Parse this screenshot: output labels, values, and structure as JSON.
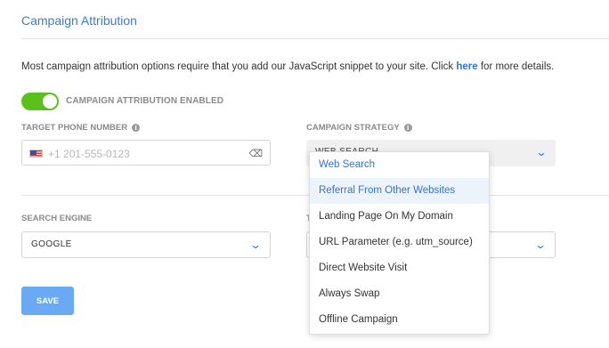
{
  "section": {
    "title": "Campaign Attribution"
  },
  "intro": {
    "text_before": "Most campaign attribution options require that you add our JavaScript snippet to your site. Click ",
    "link_text": "here",
    "text_after": " for more details."
  },
  "toggle": {
    "label": "CAMPAIGN ATTRIBUTION ENABLED",
    "on": true,
    "color": "#5cc01c"
  },
  "phone": {
    "label": "TARGET PHONE NUMBER",
    "placeholder": "+1 201-555-0123",
    "info_icon": "info-icon",
    "flag_icon": "us-flag-icon",
    "clear_icon": "eraser-icon"
  },
  "strategy": {
    "label": "CAMPAIGN STRATEGY",
    "value": "WEB SEARCH",
    "info_icon": "info-icon",
    "options": [
      "Web Search",
      "Referral From Other Websites",
      "Landing Page On My Domain",
      "URL Parameter (e.g. utm_source)",
      "Direct Website Visit",
      "Always Swap",
      "Offline Campaign"
    ],
    "selected_index": 0,
    "hover_index": 1
  },
  "engine": {
    "label": "SEARCH ENGINE",
    "value": "GOOGLE"
  },
  "right_field": {
    "label_partial": "T"
  },
  "save": {
    "label": "SAVE",
    "color": "#6aaaf5"
  },
  "colors": {
    "accent": "#2f73d6",
    "title": "#3a7bd5"
  }
}
